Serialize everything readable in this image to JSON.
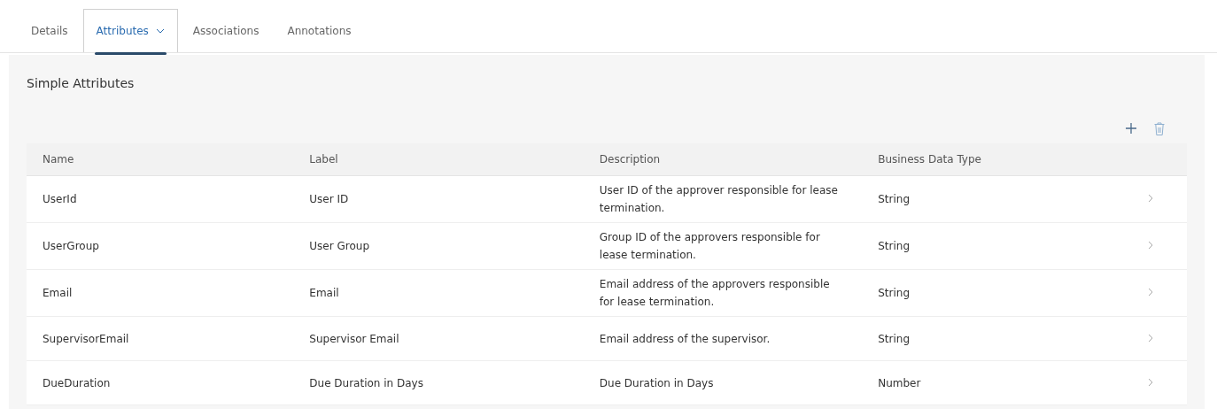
{
  "tabs": [
    {
      "label": "Details",
      "selected": false,
      "has_menu": false
    },
    {
      "label": "Attributes",
      "selected": true,
      "has_menu": true
    },
    {
      "label": "Associations",
      "selected": false,
      "has_menu": false
    },
    {
      "label": "Annotations",
      "selected": false,
      "has_menu": false
    }
  ],
  "section": {
    "title": "Simple Attributes"
  },
  "table": {
    "columns": [
      "Name",
      "Label",
      "Description",
      "Business Data Type"
    ],
    "rows": [
      {
        "cells": [
          "UserId",
          "User ID",
          "User ID of the approver responsible for lease termination.",
          "String"
        ]
      },
      {
        "cells": [
          "UserGroup",
          "User Group",
          "Group ID of the approvers responsible for lease termination.",
          "String"
        ]
      },
      {
        "cells": [
          "Email",
          "Email",
          "Email address of the approvers responsible for lease termination.",
          "String"
        ]
      },
      {
        "cells": [
          "SupervisorEmail",
          "Supervisor Email",
          "Email address of the supervisor.",
          "String"
        ]
      },
      {
        "cells": [
          "DueDuration",
          "Due Duration in Days",
          "Due Duration in Days",
          "Number"
        ]
      }
    ]
  }
}
